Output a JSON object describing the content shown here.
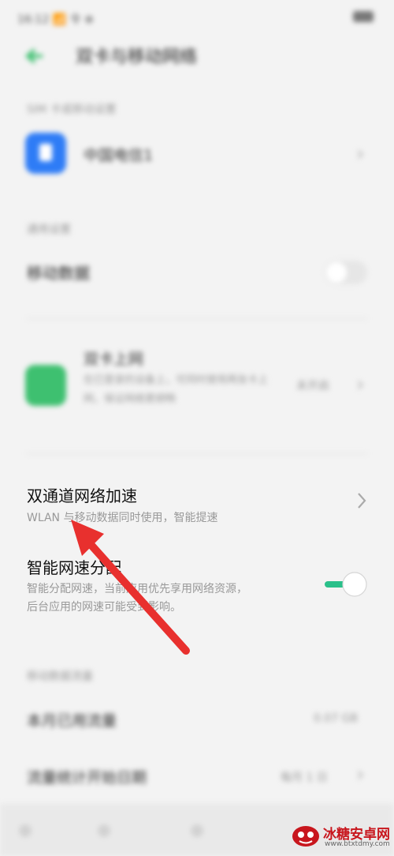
{
  "status_bar": {
    "time": "16:12 📶 令 ⊕"
  },
  "title_bar": {
    "title": "双卡与移动网络"
  },
  "sim_section": {
    "label": "SIM 卡或移动设置",
    "sim_name": "中国电信1"
  },
  "general_section": {
    "label": "通用设置",
    "mobile_data": "移动数据"
  },
  "dual_channel_blurred": {
    "title": "双卡上网",
    "desc": "在已登录的设备上，可同时使用两张卡上网，保证网络更顺畅",
    "state": "未开启"
  },
  "dual_network": {
    "title": "双通道网络加速",
    "desc": "WLAN 与移动数据同时使用，智能提速"
  },
  "smart_speed": {
    "title": "智能网速分配",
    "desc_line1": "智能分配网速，当前应用优先享用网络资源，",
    "desc_line2": "后台应用的网速可能受到影响。",
    "enabled": true
  },
  "data_section": {
    "label": "移动数据流量",
    "monthly_usage": "本月已用流量",
    "monthly_usage_value": "0.07 GB",
    "stats_start": "流量统计开始日期",
    "stats_start_value": "每月 1 日"
  },
  "watermark": {
    "name": "冰糖安卓网",
    "url": "www.btxtdmy.com"
  },
  "colors": {
    "accent_green": "#3ec070",
    "arrow_red": "#e8302e",
    "toggle_on": "#2ac08a"
  }
}
